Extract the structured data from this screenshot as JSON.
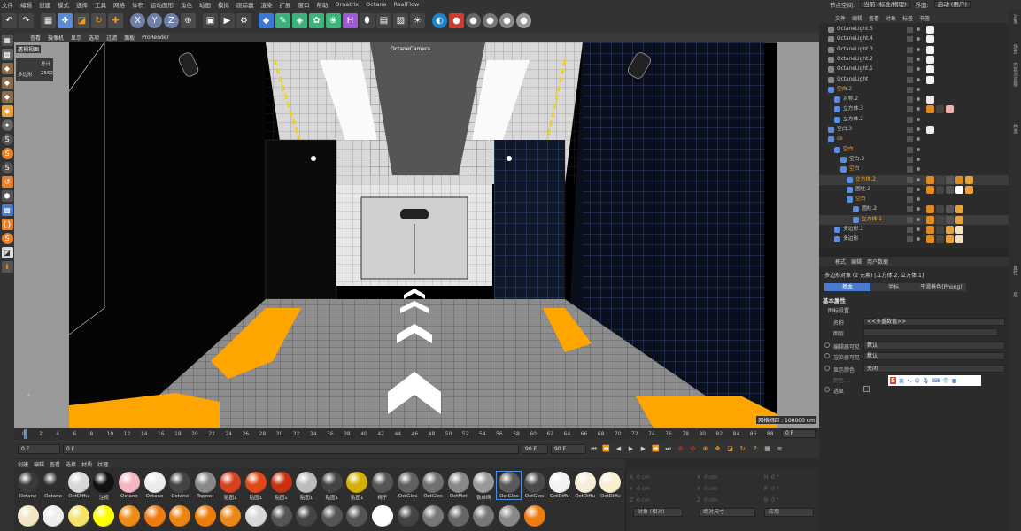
{
  "menubar": {
    "items": [
      "文件",
      "编辑",
      "创建",
      "模式",
      "选择",
      "工具",
      "网格",
      "体积",
      "运动图形",
      "角色",
      "动画",
      "模拟",
      "跟踪器",
      "渲染",
      "扩展",
      "窗口",
      "帮助",
      "Ornatrix",
      "Octane",
      "RealFlow"
    ],
    "layout_label": "节点空间:",
    "layout_value": "当前 (标准/物理)",
    "interface_label": "界面:",
    "interface_value": "启动 (用户)"
  },
  "viewport": {
    "menu": [
      "查看",
      "摄像机",
      "显示",
      "选项",
      "过滤",
      "面板",
      "ProRender"
    ],
    "view_name": "透视视图",
    "stats_label": "总计",
    "stats_row_label": "多边形",
    "stats_row_value": "2562",
    "camera_label": "OctaneCamera",
    "grid_spacing": "网格间距 : 100000 cm"
  },
  "timeline": {
    "ticks": [
      "0",
      "2",
      "4",
      "6",
      "8",
      "10",
      "12",
      "14",
      "16",
      "18",
      "20",
      "22",
      "24",
      "26",
      "28",
      "30",
      "32",
      "34",
      "36",
      "38",
      "40",
      "42",
      "44",
      "46",
      "48",
      "50",
      "52",
      "54",
      "56",
      "58",
      "60",
      "62",
      "64",
      "66",
      "68",
      "70",
      "72",
      "74",
      "76",
      "78",
      "80",
      "82",
      "84",
      "86",
      "88",
      "90"
    ],
    "current_frame": "0 F",
    "start_field": "0 F",
    "preview_start": "0 F",
    "end_field": "90 F",
    "preview_end": "90 F"
  },
  "materials": {
    "menu": [
      "创建",
      "编辑",
      "查看",
      "选择",
      "材质",
      "纹理"
    ],
    "items": [
      {
        "label": "Octane",
        "color": "#3a3a3a"
      },
      {
        "label": "Octane",
        "color": "#2e2e2e"
      },
      {
        "label": "OctDiffu",
        "color": "#d8d8d8"
      },
      {
        "label": "注视",
        "color": "#111111"
      },
      {
        "label": "Octane",
        "color": "#f4b6c0"
      },
      {
        "label": "Octane",
        "color": "#ececec"
      },
      {
        "label": "Octane",
        "color": "#444444"
      },
      {
        "label": "Topowi",
        "color": "#888888"
      },
      {
        "label": "贴图1",
        "color": "#d84020"
      },
      {
        "label": "贴图1",
        "color": "#e04818"
      },
      {
        "label": "贴图1",
        "color": "#c83010"
      },
      {
        "label": "贴图1",
        "color": "#bbbbbb"
      },
      {
        "label": "贴图1",
        "color": "#444444"
      },
      {
        "label": "贴图1",
        "color": "#d4b100"
      },
      {
        "label": "椅子",
        "color": "#555555"
      },
      {
        "label": "OctGlos",
        "color": "#606060"
      },
      {
        "label": "OctGlos",
        "color": "#707070"
      },
      {
        "label": "OctMet",
        "color": "#888888"
      },
      {
        "label": "铁丝网",
        "color": "#999999"
      },
      {
        "label": "OctGlos",
        "color": "#5a5a5a"
      },
      {
        "label": "OctGlos",
        "color": "#4a4a4a"
      },
      {
        "label": "OctDiffu",
        "color": "#f2f2f2"
      },
      {
        "label": "OctDiffu",
        "color": "#f7eed8"
      },
      {
        "label": "OctDiffu",
        "color": "#f7efd0"
      }
    ],
    "row2": [
      "#f3e4c4",
      "#eeeeee",
      "#f5e36a",
      "#ffff00",
      "#f08c14",
      "#f07c10",
      "#ec8412",
      "#ef7d0c",
      "#ec8816",
      "#d8d8d8",
      "#555555",
      "#444444",
      "#555555",
      "#555555",
      "#ffffff",
      "#444444",
      "#777777",
      "#666666",
      "#777777",
      "#888888",
      "#f07c10"
    ]
  },
  "coords": {
    "rows": [
      {
        "a": "X",
        "av": "0 cm",
        "b": "X",
        "bv": "0 cm",
        "c": "H",
        "cv": "0 °"
      },
      {
        "a": "Y",
        "av": "0 cm",
        "b": "Y",
        "bv": "0 cm",
        "c": "P",
        "cv": "0 °"
      },
      {
        "a": "Z",
        "av": "0 cm",
        "b": "Z",
        "bv": "0 cm",
        "c": "B",
        "cv": "0 °"
      }
    ],
    "mode": "对象 (相对)",
    "size_mode": "绝对尺寸",
    "apply": "应用"
  },
  "object_manager": {
    "menu": [
      "文件",
      "编辑",
      "查看",
      "对象",
      "标签",
      "书签"
    ],
    "rows": [
      {
        "name": "OctaneLight.5",
        "indent": 0
      },
      {
        "name": "OctaneLight.4",
        "indent": 0
      },
      {
        "name": "OctaneLight.3",
        "indent": 0
      },
      {
        "name": "OctaneLight.2",
        "indent": 0
      },
      {
        "name": "OctaneLight.1",
        "indent": 0
      },
      {
        "name": "OctaneLight",
        "indent": 0
      },
      {
        "name": "空白.2",
        "indent": 0,
        "color": "#e8a23c"
      },
      {
        "name": "对称.2",
        "indent": 1
      },
      {
        "name": "立方体.3",
        "indent": 1
      },
      {
        "name": "立方体.2",
        "indent": 1
      },
      {
        "name": "空白.3",
        "indent": 0
      },
      {
        "name": "ce",
        "indent": 0,
        "color": "#e8a23c"
      },
      {
        "name": "空白",
        "indent": 1,
        "color": "#e8a23c"
      },
      {
        "name": "空白.3",
        "indent": 2
      },
      {
        "name": "空白",
        "indent": 2,
        "color": "#e8a23c"
      },
      {
        "name": "立方体.2",
        "indent": 3,
        "color": "#ffb000"
      },
      {
        "name": "圆柱.3",
        "indent": 3
      },
      {
        "name": "空白",
        "indent": 3,
        "color": "#e8a23c"
      },
      {
        "name": "圆柱.2",
        "indent": 4
      },
      {
        "name": "立方体.1",
        "indent": 4,
        "color": "#ffb000"
      },
      {
        "name": "多边形.1",
        "indent": 1
      },
      {
        "name": "多边形",
        "indent": 1
      }
    ]
  },
  "attributes": {
    "menu": [
      "模式",
      "编辑",
      "用户数据"
    ],
    "title": "多边形对象 (2 元素) [立方体.2, 立方体.1]",
    "tabs": [
      "基本",
      "坐标",
      "平滑着色(Phong)"
    ],
    "section": "基本属性",
    "subsection": "图标设置",
    "name_label": "名称",
    "name_value": "<<多重数值>>",
    "layer_label": "图层",
    "editor_label": "编辑器可见",
    "editor_value": "默认",
    "render_label": "渲染器可见",
    "render_value": "默认",
    "color_label": "显示颜色",
    "color_value": "关闭",
    "color2_label": "颜色 ...",
    "xray_label": "透显",
    "ime_label": "英"
  },
  "right_strip": [
    "对象",
    "场景",
    "内容浏览器",
    "构造",
    "属性",
    "层"
  ]
}
